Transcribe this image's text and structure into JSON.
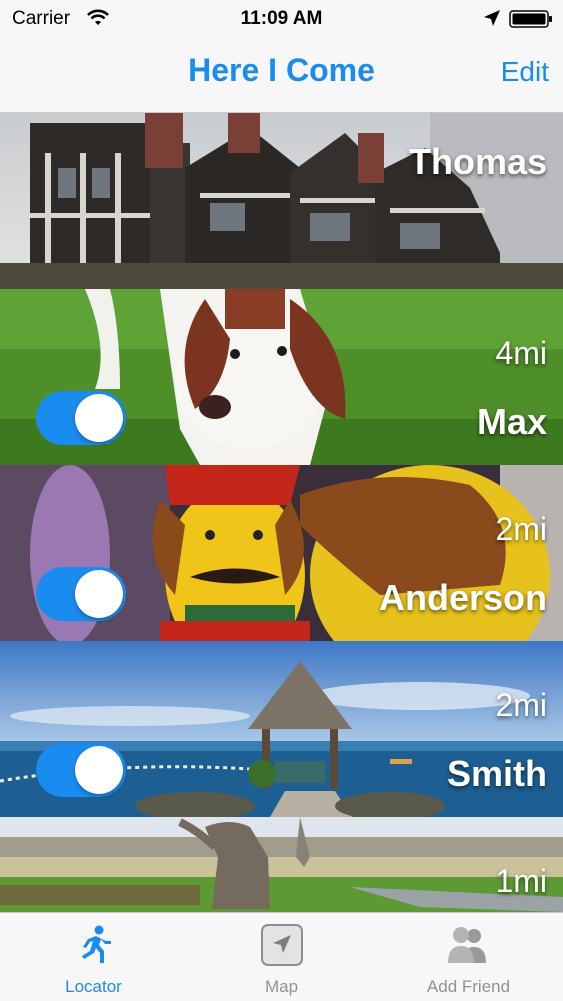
{
  "status_bar": {
    "carrier": "Carrier",
    "time": "11:09 AM"
  },
  "nav": {
    "title": "Here I Come",
    "edit_label": "Edit"
  },
  "friends": [
    {
      "name": "Thomas",
      "distance": "",
      "toggle_on": null,
      "photo": "tudor-house"
    },
    {
      "name": "Max",
      "distance": "4mi",
      "toggle_on": true,
      "photo": "spaniel-dog"
    },
    {
      "name": "Anderson",
      "distance": "2mi",
      "toggle_on": true,
      "photo": "toy-figures"
    },
    {
      "name": "Smith",
      "distance": "2mi",
      "toggle_on": true,
      "photo": "seaside-gazebo"
    },
    {
      "name": "",
      "distance": "1mi",
      "toggle_on": null,
      "photo": "park-tree"
    }
  ],
  "tabs": [
    {
      "label": "Locator",
      "icon": "runner-icon",
      "active": true
    },
    {
      "label": "Map",
      "icon": "map-arrow-icon",
      "active": false
    },
    {
      "label": "Add Friend",
      "icon": "add-friend-icon",
      "active": false
    }
  ],
  "colors": {
    "accent": "#1a8cf0",
    "inactive": "#929292"
  }
}
